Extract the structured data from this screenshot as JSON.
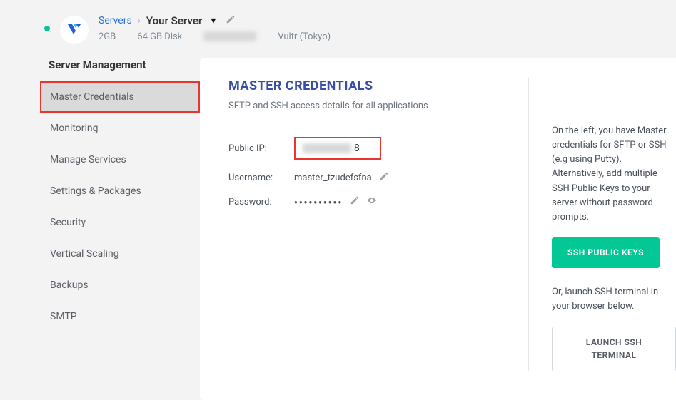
{
  "header": {
    "breadcrumb_root": "Servers",
    "breadcrumb_current": "Your Server",
    "spec_ram": "2GB",
    "spec_disk": "64 GB Disk",
    "spec_provider": "Vultr (Tokyo)"
  },
  "sidebar": {
    "title": "Server Management",
    "items": [
      {
        "label": "Master Credentials",
        "active": true
      },
      {
        "label": "Monitoring",
        "active": false
      },
      {
        "label": "Manage Services",
        "active": false
      },
      {
        "label": "Settings & Packages",
        "active": false
      },
      {
        "label": "Security",
        "active": false
      },
      {
        "label": "Vertical Scaling",
        "active": false
      },
      {
        "label": "Backups",
        "active": false
      },
      {
        "label": "SMTP",
        "active": false
      }
    ]
  },
  "panel": {
    "title": "MASTER CREDENTIALS",
    "subtitle": "SFTP and SSH access details for all applications",
    "fields": {
      "ip_label": "Public IP:",
      "ip_suffix": "8",
      "username_label": "Username:",
      "username_value": "master_tzudefsfna",
      "password_label": "Password:",
      "password_mask": "●●●●●●●●●●"
    },
    "help": {
      "p1": "On the left, you have Master credentials for SFTP or SSH (e.g using Putty). Alternatively, add multiple SSH Public Keys to your server without password prompts.",
      "btn_keys": "SSH PUBLIC KEYS",
      "p2": "Or, launch SSH terminal in your browser below.",
      "btn_launch": "LAUNCH SSH TERMINAL"
    }
  }
}
